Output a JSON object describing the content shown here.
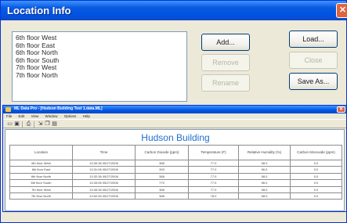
{
  "dialog": {
    "title": "Location Info",
    "close_glyph": "✕",
    "locations": [
      "6th floor West",
      "6th floor East",
      "6th floor North",
      "6th floor South",
      "7th floor West",
      "7th floor North"
    ],
    "buttons": {
      "add": "Add...",
      "remove": "Remove",
      "rename": "Rename",
      "load": "Load...",
      "close": "Close",
      "save_as": "Save As..."
    }
  },
  "app": {
    "title": "ML Data Pro - [Hudson Building Test 1.data.ML]",
    "close_glyph": "✕",
    "menu": [
      "File",
      "Edit",
      "View",
      "Window",
      "Options",
      "Help"
    ],
    "toolbar_icons": [
      "open-icon",
      "save-icon",
      "print-icon",
      "export-icon",
      "copy-icon",
      "chart-icon"
    ],
    "document_title": "Hudson Building",
    "columns": [
      "Location",
      "Time",
      "Carbon Dioxide (ppm)",
      "Temperature (F)",
      "Relative Humidity (%)",
      "Carbon Monoxide (ppm)"
    ],
    "rows": [
      [
        "6th floor West",
        "13:30:36 05/27/2006",
        "388",
        "77.0",
        "58.0",
        "0.0"
      ],
      [
        "6th floor East",
        "13:31:06 05/27/2006",
        "393",
        "77.0",
        "56.0",
        "0.0"
      ],
      [
        "6th floor North",
        "13:32:36 05/27/2006",
        "388",
        "77.0",
        "58.0",
        "0.0"
      ],
      [
        "6th floor South",
        "13:33:06 05/27/2006",
        "770",
        "77.0",
        "56.0",
        "0.0"
      ],
      [
        "7th floor West",
        "13:45:36 05/27/2006",
        "388",
        "77.0",
        "58.0",
        "0.0"
      ],
      [
        "7th floor North",
        "13:52:06 05/27/2006",
        "388",
        "78.0",
        "58.0",
        "0.0"
      ]
    ]
  }
}
